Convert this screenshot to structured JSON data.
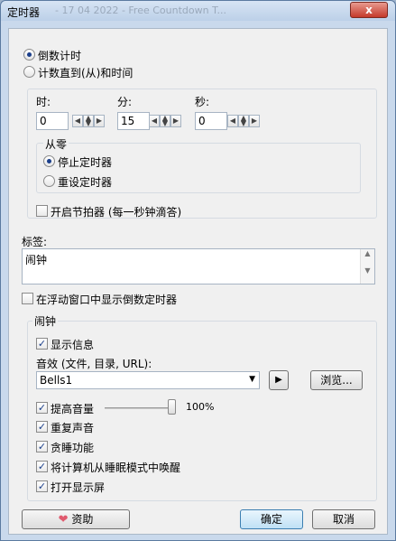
{
  "window": {
    "title": "定时器",
    "background_title": "- 17 04 2022 - Free Countdown T...",
    "close_label": "x"
  },
  "mode": {
    "countdown_label": "倒数计时",
    "countup_label": "计数直到(从)和时间"
  },
  "time": {
    "hours_label": "时:",
    "hours_value": "0",
    "minutes_label": "分:",
    "minutes_value": "15",
    "seconds_label": "秒:",
    "seconds_value": "0"
  },
  "from_zero": {
    "label": "从零",
    "stop_label": "停止定时器",
    "reset_label": "重设定时器"
  },
  "metronome_label": "开启节拍器 (每一秒钟滴答)",
  "tag": {
    "label": "标签:",
    "value": "闹钟"
  },
  "floating_label": "在浮动窗口中显示倒数定时器",
  "alarm": {
    "label": "闹钟",
    "show_message_label": "显示信息",
    "sound_label": "音效 (文件, 目录, URL):",
    "sound_value": "Bells1",
    "browse_label": "浏览...",
    "raise_volume_label": "提高音量",
    "volume_percent": "100%",
    "volume_level": 1.0,
    "repeat_label": "重复声音",
    "snooze_label": "贪睡功能",
    "wake_label": "将计算机从睡眠模式中唤醒",
    "display_on_label": "打开显示屏"
  },
  "footer": {
    "donate_label": "资助",
    "ok_label": "确定",
    "cancel_label": "取消"
  },
  "icons": {
    "close": "close-icon",
    "play": "play-icon",
    "heart": "heart-icon",
    "dropdown": "chevron-down-icon"
  },
  "colors": {
    "accent": "#1b3f8b",
    "title_gradient_top": "#d7e4f4",
    "close_red": "#c4392a",
    "heart": "#e05a6e"
  }
}
